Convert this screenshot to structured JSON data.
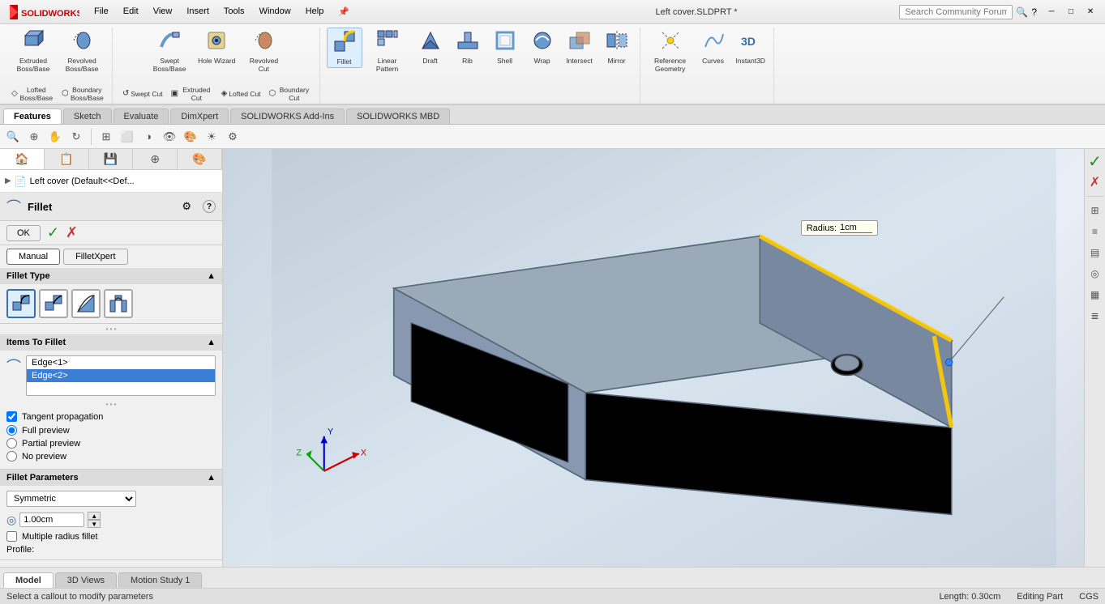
{
  "titlebar": {
    "title": "Left cover.SLDPRT *",
    "search_placeholder": "Search Community Forum",
    "menu_items": [
      "File",
      "Edit",
      "View",
      "Insert",
      "Tools",
      "Window",
      "Help"
    ],
    "pin_label": "📌"
  },
  "ribbon": {
    "groups": [
      {
        "name": "boss_base",
        "buttons": [
          {
            "id": "extruded-boss",
            "label": "Extruded Boss/Base",
            "icon": "⬜"
          },
          {
            "id": "revolved-boss",
            "label": "Revolved Boss/Base",
            "icon": "⭕"
          },
          {
            "id": "lofted-boss",
            "label": "Lofted Boss/Base",
            "icon": "◇"
          },
          {
            "id": "boundary-boss",
            "label": "Boundary Boss/Base",
            "icon": "⬡"
          }
        ]
      },
      {
        "name": "cut",
        "buttons": [
          {
            "id": "swept-boss",
            "label": "Swept Boss/Base",
            "icon": "⟳"
          },
          {
            "id": "hole-wizard",
            "label": "Hole Wizard",
            "icon": "◎"
          },
          {
            "id": "revolved-cut",
            "label": "Revolved Cut",
            "icon": "⊘"
          },
          {
            "id": "swept-cut",
            "label": "Swept Cut",
            "icon": "↺"
          },
          {
            "id": "extruded-cut",
            "label": "Extruded Cut",
            "icon": "▣"
          },
          {
            "id": "lofted-cut",
            "label": "Lofted Cut",
            "icon": "◈"
          },
          {
            "id": "boundary-cut",
            "label": "Boundary Cut",
            "icon": "⬡"
          }
        ]
      },
      {
        "name": "features",
        "buttons": [
          {
            "id": "fillet",
            "label": "Fillet",
            "icon": "⌒"
          },
          {
            "id": "linear-pattern",
            "label": "Linear Pattern",
            "icon": "⊞"
          },
          {
            "id": "draft",
            "label": "Draft",
            "icon": "◥"
          },
          {
            "id": "rib",
            "label": "Rib",
            "icon": "▬"
          },
          {
            "id": "shell",
            "label": "Shell",
            "icon": "□"
          },
          {
            "id": "wrap",
            "label": "Wrap",
            "icon": "↩"
          },
          {
            "id": "intersect",
            "label": "Intersect",
            "icon": "⊗"
          },
          {
            "id": "mirror",
            "label": "Mirror",
            "icon": "⟺"
          }
        ]
      },
      {
        "name": "ref_geo",
        "buttons": [
          {
            "id": "reference-geometry",
            "label": "Reference Geometry",
            "icon": "✦"
          },
          {
            "id": "curves",
            "label": "Curves",
            "icon": "∿"
          },
          {
            "id": "instant3d",
            "label": "Instant3D",
            "icon": "3D"
          }
        ]
      }
    ]
  },
  "tabs": {
    "items": [
      "Features",
      "Sketch",
      "Evaluate",
      "DimXpert",
      "SOLIDWORKS Add-Ins",
      "SOLIDWORKS MBD"
    ]
  },
  "left_panel": {
    "tabs": [
      "🏠",
      "📋",
      "💾",
      "⊕",
      "🎨"
    ],
    "feature_tree": {
      "arrow": "▶",
      "icon": "📄",
      "label": "Left cover  (Default<<Def..."
    }
  },
  "fillet": {
    "title": "Fillet",
    "help_icon": "?",
    "settings_icon": "⚙",
    "ok_label": "OK",
    "check_label": "✓",
    "cross_label": "✗",
    "tabs": [
      "Manual",
      "FilletXpert"
    ],
    "active_tab": "Manual",
    "sections": {
      "fillet_type": {
        "title": "Fillet Type",
        "icons": [
          {
            "id": "constant",
            "label": "Constant size",
            "active": true
          },
          {
            "id": "variable",
            "label": "Variable size",
            "active": false
          },
          {
            "id": "face",
            "label": "Face fillet",
            "active": false
          },
          {
            "id": "full",
            "label": "Full round fillet",
            "active": false
          }
        ]
      },
      "items_to_fillet": {
        "title": "Items To Fillet",
        "edges": [
          {
            "id": "edge1",
            "label": "Edge<1>",
            "selected": false
          },
          {
            "id": "edge2",
            "label": "Edge<2>",
            "selected": true
          }
        ],
        "tangent_propagation": true,
        "preview_options": [
          "Full preview",
          "Partial preview",
          "No preview"
        ],
        "active_preview": "Full preview"
      },
      "fillet_parameters": {
        "title": "Fillet Parameters",
        "type_dropdown": "Symmetric",
        "radius_value": "1.00cm",
        "multiple_radius_fillet": false,
        "profile_label": "Profile:"
      }
    }
  },
  "viewport": {
    "radius_label": "Radius:",
    "radius_value": "1cm"
  },
  "bottom_tabs": [
    "Model",
    "3D Views",
    "Motion Study 1"
  ],
  "status_bar": {
    "message": "Select a callout to modify parameters",
    "length": "Length: 0.30cm",
    "mode": "Editing Part",
    "units": "CGS"
  },
  "right_sidebar": {
    "green_check": "✓",
    "red_cross": "✗",
    "icons": [
      "⊞",
      "≡",
      "▤",
      "◎",
      "▦",
      "≣"
    ]
  }
}
